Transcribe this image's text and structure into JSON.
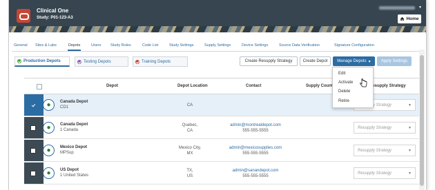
{
  "header": {
    "app_title": "Clinical One",
    "study": "Study: P01-123-A3",
    "home_label": "Home",
    "user_caret": "▾"
  },
  "tabs": [
    {
      "label": "General",
      "active": false
    },
    {
      "label": "Sites & Labs",
      "active": false
    },
    {
      "label": "Depots",
      "active": true
    },
    {
      "label": "Users",
      "active": false
    },
    {
      "label": "Study Roles",
      "active": false
    },
    {
      "label": "Code List",
      "active": false
    },
    {
      "label": "Study Settings",
      "active": false
    },
    {
      "label": "Supply Settings",
      "active": false
    },
    {
      "label": "Device Settings",
      "active": false
    },
    {
      "label": "Source Data Verification",
      "active": false
    },
    {
      "label": "Signature Configuration",
      "active": false
    }
  ],
  "subtabs": {
    "production": "Production Depots",
    "testing": "Testing Depots",
    "training": "Training Depots"
  },
  "toolbar": {
    "create_resupply": "Create Resupply Strategy",
    "create_depot": "Create Depot",
    "manage_depots": "Manage Depots",
    "apply_settings": "Apply Settings"
  },
  "menu": {
    "items": [
      "Edit",
      "Activate",
      "Delete",
      "Retire"
    ]
  },
  "table": {
    "columns": [
      "Depot",
      "Depot Location",
      "Contact",
      "Supply Countries",
      "Resupply Strategy"
    ],
    "rows": [
      {
        "name": "Canada Depot",
        "code": "CD1",
        "location1": "CA",
        "location2": "",
        "email": "",
        "phone": "",
        "resupply": "Resupply Strategy",
        "selected": true
      },
      {
        "name": "Canada Depot",
        "code": "1 Canada",
        "location1": "Quebec,",
        "location2": "CA",
        "email": "admin@montrealdepot.com",
        "phone": "555-555-5555",
        "resupply": "Resupply Strategy",
        "selected": false
      },
      {
        "name": "Mexico Depot",
        "code": "MPSup",
        "location1": "Mexico City,",
        "location2": "MX",
        "email": "admin@mexicosupplies.com",
        "phone": "555-555-5555",
        "resupply": "Resupply Strategy",
        "selected": false
      },
      {
        "name": "US Depot",
        "code": "1 United States",
        "location1": "TX,",
        "location2": "US",
        "email": "admin@sanandepot.com",
        "phone": "555-555-5555",
        "resupply": "Resupply Strategy",
        "selected": false
      }
    ]
  },
  "colors": {
    "header_bg": "#36454f",
    "brand_red": "#c74634",
    "accent_blue": "#2b6ca3"
  }
}
